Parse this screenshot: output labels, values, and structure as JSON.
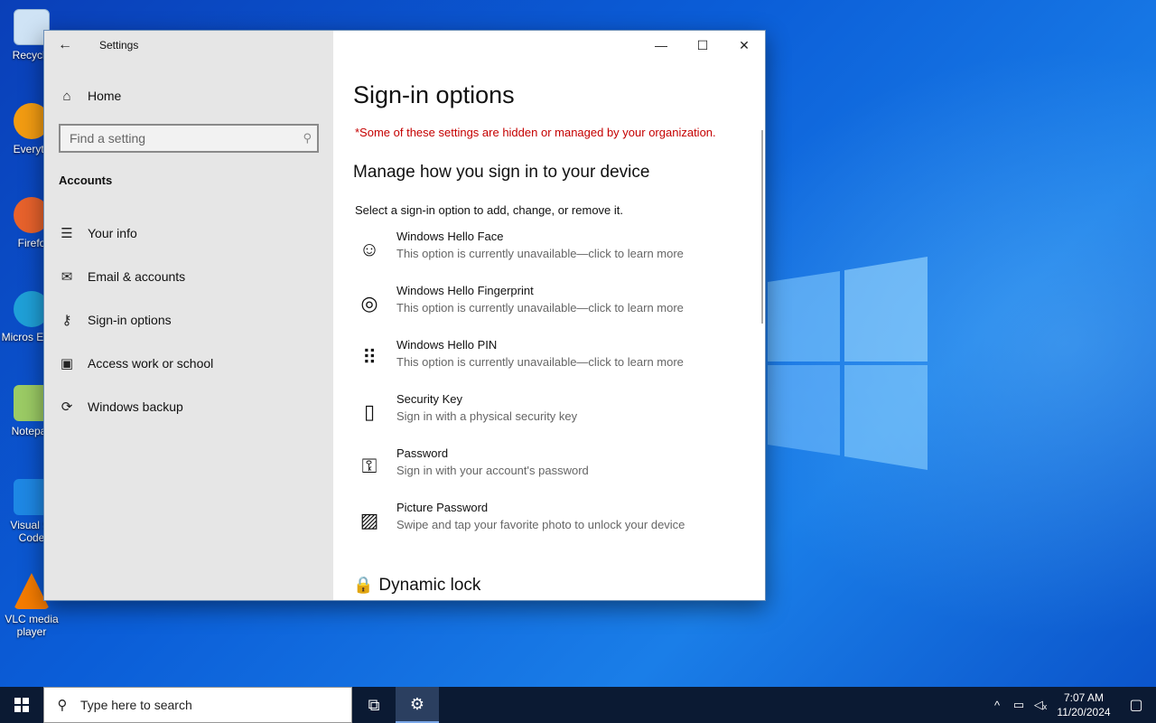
{
  "desktop": {
    "icons": [
      {
        "label": "Recycle",
        "color": "#cfe3f5"
      },
      {
        "label": "Everyth",
        "color": "#f39c12"
      },
      {
        "label": "Firefo",
        "color": "#e8622c"
      },
      {
        "label": "Micros Edge",
        "color": "#1fa0d8"
      },
      {
        "label": "Notepac",
        "color": "#9ccc65"
      },
      {
        "label": "Visual St Code",
        "color": "#1e88e5"
      },
      {
        "label": "VLC media player",
        "color": "#f57c00"
      }
    ]
  },
  "window": {
    "title": "Settings",
    "controls": {
      "minimize": "—",
      "maximize": "☐",
      "close": "✕"
    }
  },
  "sidebar": {
    "home_label": "Home",
    "search_placeholder": "Find a setting",
    "section_label": "Accounts",
    "items": [
      {
        "label": "Your info",
        "icon": "person-list-icon"
      },
      {
        "label": "Email & accounts",
        "icon": "mail-icon"
      },
      {
        "label": "Sign-in options",
        "icon": "key-icon"
      },
      {
        "label": "Access work or school",
        "icon": "briefcase-icon"
      },
      {
        "label": "Windows backup",
        "icon": "sync-icon"
      }
    ]
  },
  "content": {
    "page_title": "Sign-in options",
    "org_warning": "*Some of these settings are hidden or managed by your organization.",
    "section_head": "Manage how you sign in to your device",
    "instruction": "Select a sign-in option to add, change, or remove it.",
    "options": [
      {
        "title": "Windows Hello Face",
        "subtitle": "This option is currently unavailable—click to learn more",
        "icon": "face-icon"
      },
      {
        "title": "Windows Hello Fingerprint",
        "subtitle": "This option is currently unavailable—click to learn more",
        "icon": "fingerprint-icon"
      },
      {
        "title": "Windows Hello PIN",
        "subtitle": "This option is currently unavailable—click to learn more",
        "icon": "pin-keypad-icon"
      },
      {
        "title": "Security Key",
        "subtitle": "Sign in with a physical security key",
        "icon": "usb-key-icon"
      },
      {
        "title": "Password",
        "subtitle": "Sign in with your account's password",
        "icon": "password-key-icon"
      },
      {
        "title": "Picture Password",
        "subtitle": "Swipe and tap your favorite photo to unlock your device",
        "icon": "picture-icon"
      }
    ],
    "dynamic_lock_head": "Dynamic lock"
  },
  "taskbar": {
    "search_placeholder": "Type here to search",
    "time": "7:07 AM",
    "date": "11/20/2024"
  },
  "colors": {
    "warning": "#c50000",
    "taskbar": "#0b1a33",
    "sidebar": "#e6e6e6"
  }
}
